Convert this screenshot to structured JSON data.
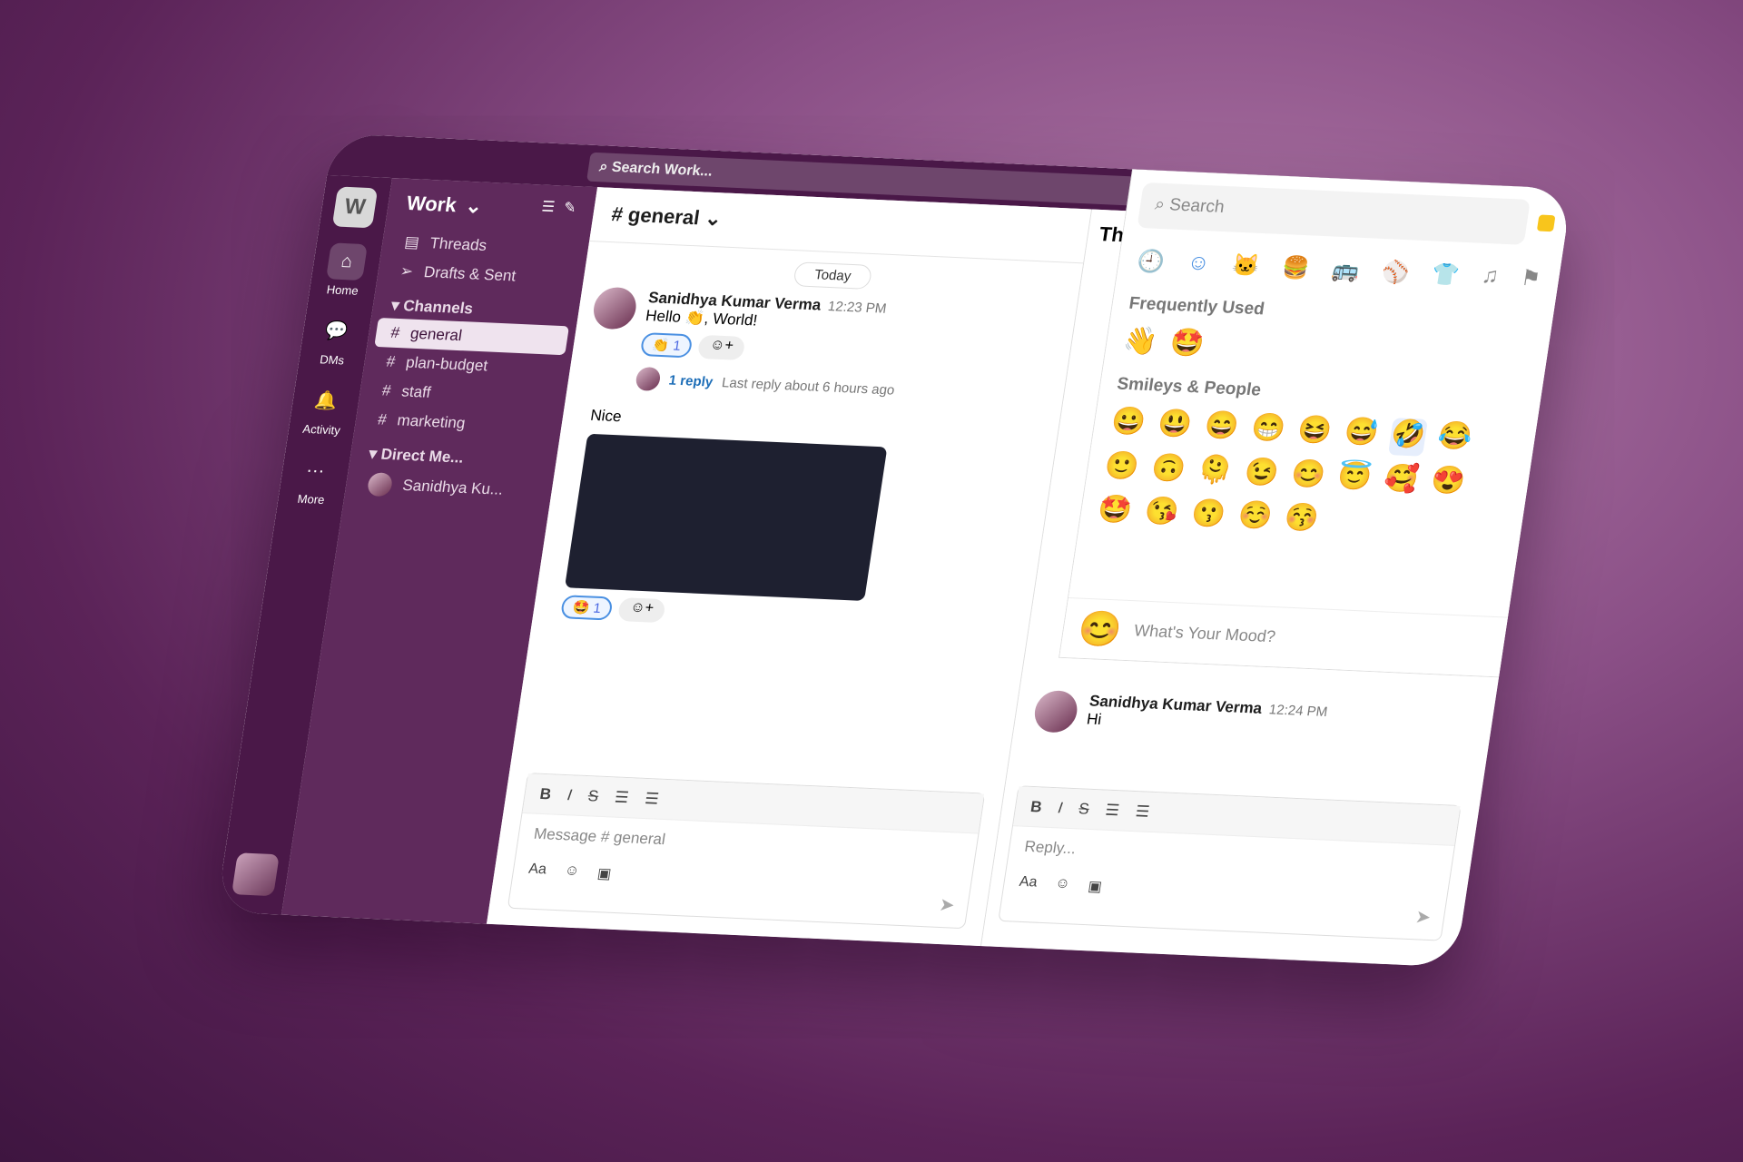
{
  "topbar": {
    "search_placeholder": "Search Work..."
  },
  "rail": {
    "workspace_initial": "W",
    "items": [
      {
        "label": "Home",
        "icon": "⌂"
      },
      {
        "label": "DMs",
        "icon": "💬"
      },
      {
        "label": "Activity",
        "icon": "🔔"
      },
      {
        "label": "More",
        "icon": "···"
      }
    ]
  },
  "sidebar": {
    "workspace": "Work",
    "items": [
      {
        "label": "Threads",
        "icon": "▤"
      },
      {
        "label": "Drafts & Sent",
        "icon": "➢"
      }
    ],
    "channels_label": "Channels",
    "channels": [
      "general",
      "plan-budget",
      "staff",
      "marketing"
    ],
    "dm_label": "Direct Me...",
    "dms": [
      "Sanidhya Ku..."
    ]
  },
  "channel": {
    "title": "# general",
    "date_divider": "Today",
    "message": {
      "author": "Sanidhya Kumar Verma",
      "time": "12:23 PM",
      "text": "Hello 👏, World!",
      "reaction": "👏",
      "reaction_count": "1",
      "reply_count": "1 reply",
      "last_reply": "Last reply about 6 hours ago"
    },
    "message2": {
      "text": "Nice",
      "reaction": "🤩",
      "reaction_count": "1"
    },
    "composer": {
      "placeholder": "Message # general",
      "bold": "B",
      "italic": "I",
      "strike": "S",
      "ol": "☰",
      "ul": "☰",
      "aa": "Aa",
      "emoji": "☺",
      "image": "▣",
      "send": "➤"
    }
  },
  "thread": {
    "title": "Th",
    "reply": {
      "author": "Sanidhya Kumar Verma",
      "time": "12:24 PM",
      "text": "Hi"
    },
    "composer": {
      "placeholder": "Reply..."
    }
  },
  "emoji_picker": {
    "search_placeholder": "Search",
    "categories": [
      "🕘",
      "☺",
      "🐱",
      "🍔",
      "🚌",
      "⚾",
      "👕",
      "♫",
      "⚑"
    ],
    "frequent_label": "Frequently Used",
    "frequent": [
      "👋",
      "🤩"
    ],
    "smileys_label": "Smileys & People",
    "smileys": [
      "😀",
      "😃",
      "😄",
      "😁",
      "😆",
      "😅",
      "🤣",
      "😂",
      "🙂",
      "🙃",
      "🫠",
      "😉",
      "😊",
      "😇",
      "🥰",
      "😍",
      "🤩",
      "😘",
      "😗",
      "☺️",
      "😚"
    ],
    "mood_placeholder": "What's Your Mood?",
    "mood_emoji": "😊"
  },
  "colors": {
    "rail": "#4a1848",
    "sidebar": "#5f2a5c",
    "accent": "#4a90e2"
  }
}
